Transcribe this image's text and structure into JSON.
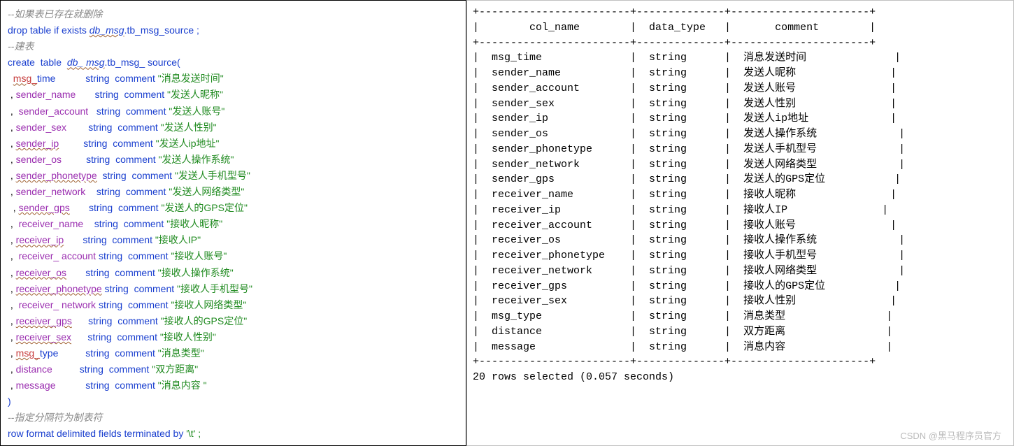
{
  "sql": {
    "c1": "--如果表已存在就删除",
    "drop_kw1": "drop",
    "drop_kw2": "table",
    "drop_kw3": "if exists",
    "drop_db": "db_msg",
    "drop_tbl": ".tb_msg_source ;",
    "c2": "--建表",
    "create_kw1": "create",
    "create_kw2": "table",
    "create_db": "db_ msg",
    "create_tbl": ".tb_msg_ source(",
    "cols": [
      {
        "pre": "  ",
        "name": "msg_",
        "suf": "time",
        "type": "string",
        "ckw": "comment",
        "cmt": "\"消息发送时间\"",
        "red": true,
        "wavy": true
      },
      {
        "pre": " , ",
        "name": "sender_name",
        "type": "string",
        "ckw": "comment",
        "cmt": "\"发送人昵称\""
      },
      {
        "pre": " ,  ",
        "name": "sender_account",
        "type": "string",
        "ckw": "comment",
        "cmt": "\"发送人账号\""
      },
      {
        "pre": " , ",
        "name": "sender_sex",
        "type": "string",
        "ckw": "comment",
        "cmt": "\"发送人性别\""
      },
      {
        "pre": " , ",
        "name": "sender_ip",
        "type": "string",
        "ckw": "comment",
        "cmt": "\"发送人ip地址\"",
        "wavy": true
      },
      {
        "pre": " , ",
        "name": "sender_os",
        "type": "string",
        "ckw": "comment",
        "cmt": "\"发送人操作系统\""
      },
      {
        "pre": " , ",
        "name": "sender_phonetype",
        "type": "string",
        "ckw": "comment",
        "cmt": "\"发送人手机型号\"",
        "wavy": true
      },
      {
        "pre": " , ",
        "name": "sender_network",
        "type": "string",
        "ckw": "comment",
        "cmt": "\"发送人网络类型\""
      },
      {
        "pre": "  , ",
        "name": "sender_gps",
        "type": "string",
        "ckw": "comment",
        "cmt": "\"发送人的GPS定位\"",
        "wavy": true
      },
      {
        "pre": " ,  ",
        "name": "receiver_name",
        "type": "string",
        "ckw": "comment",
        "cmt": "\"接收人昵称\""
      },
      {
        "pre": " , ",
        "name": "receiver_ip",
        "type": "string",
        "ckw": "comment",
        "cmt": "\"接收人IP\"",
        "wavy": true
      },
      {
        "pre": " ,  ",
        "name": "receiver_ account",
        "type": "string",
        "ckw": "comment",
        "cmt": "\"接收人账号\""
      },
      {
        "pre": " , ",
        "name": "receiver_os",
        "type": "string",
        "ckw": "comment",
        "cmt": "\"接收人操作系统\"",
        "wavy": true
      },
      {
        "pre": " , ",
        "name": "receiver_phonetype",
        "type": "string",
        "ckw": "comment",
        "cmt": "\"接收人手机型号\"",
        "wavy": true
      },
      {
        "pre": " ,  ",
        "name": "receiver_ network",
        "type": "string",
        "ckw": "comment",
        "cmt": "\"接收人网络类型\""
      },
      {
        "pre": " , ",
        "name": "receiver_gps",
        "type": "string",
        "ckw": "comment",
        "cmt": "\"接收人的GPS定位\"",
        "wavy": true
      },
      {
        "pre": " , ",
        "name": "receiver_sex",
        "type": "string",
        "ckw": "comment",
        "cmt": "\"接收人性别\"",
        "wavy": true
      },
      {
        "pre": " , ",
        "name": "msg_",
        "suf": "type",
        "type": "string",
        "ckw": "comment",
        "cmt": "\"消息类型\"",
        "red": true,
        "wavy": true
      },
      {
        "pre": " , ",
        "name": "distance",
        "type": "string",
        "ckw": "comment",
        "cmt": "\"双方距离\""
      },
      {
        "pre": " , ",
        "name": "message",
        "type": "string",
        "ckw": "comment",
        "cmt": "\"消息内容 \""
      }
    ],
    "close": ")",
    "c3": "--指定分隔符为制表符",
    "fmt_kw": "row format delimited fields terminated by",
    "fmt_val": "'\\t' ;"
  },
  "desc": {
    "h1": "col_name",
    "h2": "data_type",
    "h3": "comment",
    "rows": [
      [
        "msg_time",
        "string",
        "消息发送时间"
      ],
      [
        "sender_name",
        "string",
        "发送人昵称"
      ],
      [
        "sender_account",
        "string",
        "发送人账号"
      ],
      [
        "sender_sex",
        "string",
        "发送人性别"
      ],
      [
        "sender_ip",
        "string",
        "发送人ip地址"
      ],
      [
        "sender_os",
        "string",
        "发送人操作系统"
      ],
      [
        "sender_phonetype",
        "string",
        "发送人手机型号"
      ],
      [
        "sender_network",
        "string",
        "发送人网络类型"
      ],
      [
        "sender_gps",
        "string",
        "发送人的GPS定位"
      ],
      [
        "receiver_name",
        "string",
        "接收人昵称"
      ],
      [
        "receiver_ip",
        "string",
        "接收人IP"
      ],
      [
        "receiver_account",
        "string",
        "接收人账号"
      ],
      [
        "receiver_os",
        "string",
        "接收人操作系统"
      ],
      [
        "receiver_phonetype",
        "string",
        "接收人手机型号"
      ],
      [
        "receiver_network",
        "string",
        "接收人网络类型"
      ],
      [
        "receiver_gps",
        "string",
        "接收人的GPS定位"
      ],
      [
        "receiver_sex",
        "string",
        "接收人性别"
      ],
      [
        "msg_type",
        "string",
        "消息类型"
      ],
      [
        "distance",
        "string",
        "双方距离"
      ],
      [
        "message",
        "string",
        "消息内容"
      ]
    ],
    "footer": "20 rows selected (0.057 seconds)"
  },
  "watermark": "CSDN @黑马程序员官方"
}
